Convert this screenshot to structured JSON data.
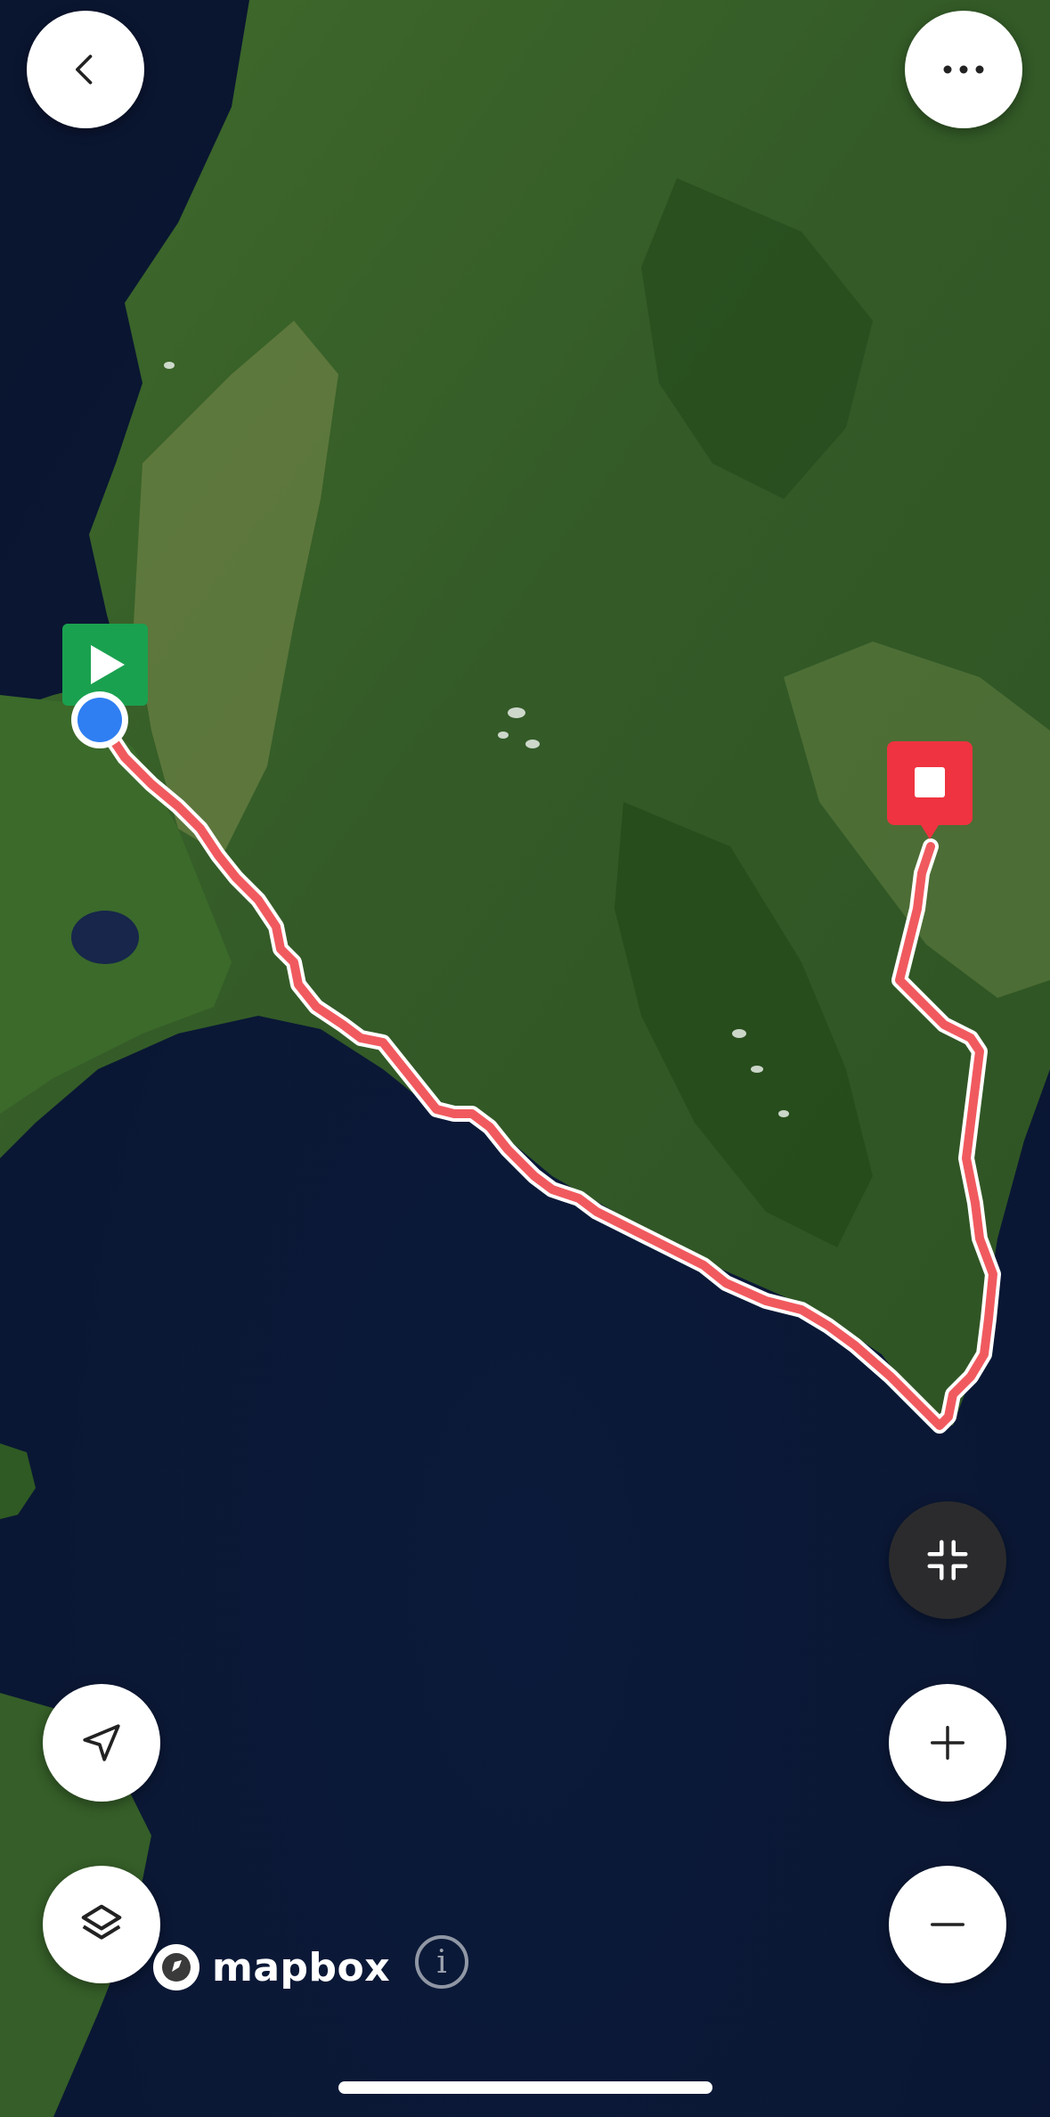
{
  "map": {
    "attribution": "mapbox",
    "info_glyph": "i",
    "route_color": "#f05a5f",
    "start_marker_color": "#1aa14f",
    "end_marker_color": "#ef3340",
    "location_dot_color": "#2f7ff2"
  },
  "controls": {
    "back": "chevron-left-icon",
    "more": "more-horizontal-icon",
    "collapse": "minimize-icon",
    "locate": "navigation-arrow-icon",
    "layers": "layers-icon",
    "zoom_in": "plus-icon",
    "zoom_out": "minus-icon"
  }
}
